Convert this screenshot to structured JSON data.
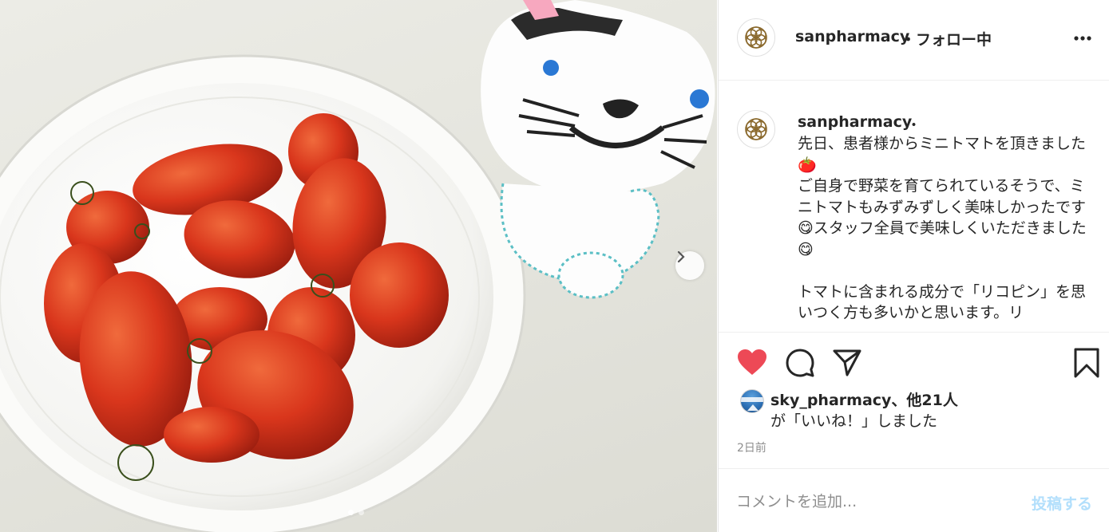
{
  "post": {
    "username": "sanpharmacy",
    "follow_status": "・フォロー中",
    "caption_separator": "・",
    "caption": "先日、患者様からミニトマトを頂きました🍅\nご自身で野菜を育てられているそうで、ミニトマトもみずみずしく美味しかったです😋スタッフ全員で美味しくいただきました😋\n\nトマトに含まれる成分で「リコピン」を思いつく方も多いかと思います。リ",
    "likes_users": "sky_pharmacy、他21人",
    "likes_suffix": "が「いいね！」しました",
    "timestamp": "2日前",
    "comment_placeholder": "コメントを追加...",
    "post_button": "投稿する",
    "carousel": {
      "slide_count": 2,
      "current": 1
    }
  },
  "icons": {
    "avatar": "sanpharmacy-logo-icon",
    "more": "more-options-icon",
    "like": "heart-icon",
    "comment": "comment-icon",
    "share": "share-icon",
    "save": "bookmark-icon",
    "next": "chevron-right-icon"
  },
  "colors": {
    "like_red": "#ed4956",
    "post_button_disabled": "#b2dffc",
    "text": "#262626",
    "muted": "#8e8e8e",
    "logo_brown": "#8b6a2e"
  }
}
